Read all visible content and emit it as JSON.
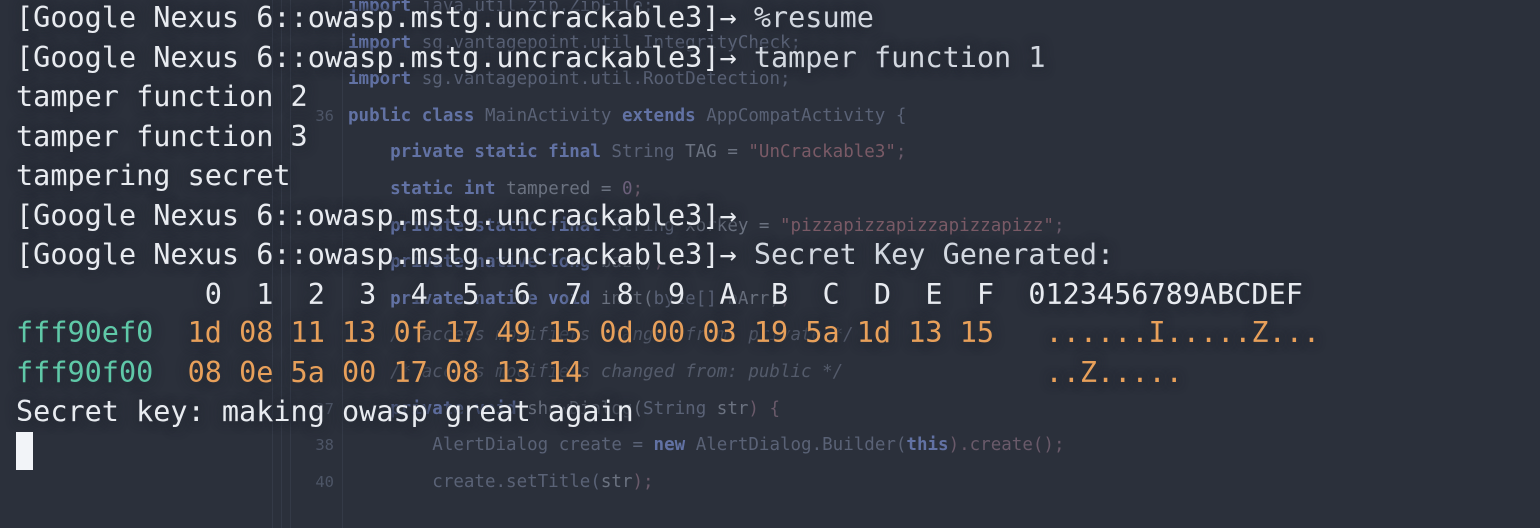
{
  "background_code": {
    "lines": [
      {
        "num": "",
        "tokens": [
          {
            "t": "import ",
            "c": "kw"
          },
          {
            "t": "java.util.zip.ZipFile;",
            "c": "typ"
          }
        ]
      },
      {
        "num": "",
        "tokens": [
          {
            "t": "import ",
            "c": "kw"
          },
          {
            "t": "sg.vantagepoint.util.IntegrityCheck;",
            "c": "typ"
          }
        ]
      },
      {
        "num": "",
        "tokens": [
          {
            "t": "import ",
            "c": "kw"
          },
          {
            "t": "sg.vantagepoint.util.RootDetection;",
            "c": "typ"
          }
        ]
      },
      {
        "num": "36",
        "tokens": [
          {
            "t": "public class ",
            "c": "kw"
          },
          {
            "t": "MainActivity ",
            "c": "typ"
          },
          {
            "t": "extends ",
            "c": "kw"
          },
          {
            "t": "AppCompatActivity {",
            "c": "typ"
          }
        ]
      },
      {
        "num": "",
        "tokens": [
          {
            "t": "    private static final ",
            "c": "kw"
          },
          {
            "t": "String ",
            "c": "typ"
          },
          {
            "t": "TAG = ",
            "c": "id"
          },
          {
            "t": "\"UnCrackable3\"",
            "c": "str"
          },
          {
            "t": ";",
            "c": "pun"
          }
        ]
      },
      {
        "num": "",
        "tokens": [
          {
            "t": "    static ",
            "c": "kw"
          },
          {
            "t": "int ",
            "c": "kw"
          },
          {
            "t": "tampered = ",
            "c": "id"
          },
          {
            "t": "0",
            "c": "num"
          },
          {
            "t": ";",
            "c": "pun"
          }
        ]
      },
      {
        "num": "",
        "tokens": [
          {
            "t": "    private static final ",
            "c": "kw"
          },
          {
            "t": "String ",
            "c": "typ"
          },
          {
            "t": "xorkey = ",
            "c": "id"
          },
          {
            "t": "\"pizzapizzapizzapizzapizz\"",
            "c": "str"
          },
          {
            "t": ";",
            "c": "pun"
          }
        ]
      },
      {
        "num": "",
        "tokens": [
          {
            "t": "    private native long ",
            "c": "kw"
          },
          {
            "t": "baz()",
            "c": "id"
          },
          {
            "t": ";",
            "c": "pun"
          }
        ]
      },
      {
        "num": "",
        "tokens": [
          {
            "t": "    private native void ",
            "c": "kw"
          },
          {
            "t": "init(",
            "c": "id"
          },
          {
            "t": "byte[] ",
            "c": "typ"
          },
          {
            "t": "bArr)",
            "c": "id"
          },
          {
            "t": ";",
            "c": "pun"
          }
        ]
      },
      {
        "num": "",
        "tokens": [
          {
            "t": "    /* access modifiers changed from: private */",
            "c": "cmt"
          }
        ]
      },
      {
        "num": "",
        "tokens": [
          {
            "t": "    /* access modifiers changed from: public */",
            "c": "cmt"
          }
        ]
      },
      {
        "num": "37",
        "tokens": [
          {
            "t": "    private void ",
            "c": "kw"
          },
          {
            "t": "showDialog(",
            "c": "id"
          },
          {
            "t": "String ",
            "c": "typ"
          },
          {
            "t": "str",
            "c": "id"
          },
          {
            "t": ") {",
            "c": "pun"
          }
        ]
      },
      {
        "num": "38",
        "tokens": [
          {
            "t": "        AlertDialog create = ",
            "c": "typ"
          },
          {
            "t": "new ",
            "c": "kw"
          },
          {
            "t": "AlertDialog.Builder(",
            "c": "typ"
          },
          {
            "t": "this",
            "c": "kw"
          },
          {
            "t": ").create()",
            "c": "pun"
          },
          {
            "t": ";",
            "c": "pun"
          }
        ]
      },
      {
        "num": "40",
        "tokens": [
          {
            "t": "        create.setTitle(",
            "c": "typ"
          },
          {
            "t": "str",
            "c": "id"
          },
          {
            "t": ");",
            "c": "pun"
          }
        ]
      }
    ]
  },
  "terminal": {
    "device_prompt": "[Google Nexus 6::owasp.mstg.uncrackable3]",
    "arrow": "→",
    "lines": [
      {
        "kind": "prompt",
        "prompt": "[Google Nexus 6::owasp.mstg.uncrackable3]",
        "arrow": "→",
        "command": " %resume"
      },
      {
        "kind": "prompt",
        "prompt": "[Google Nexus 6::owasp.mstg.uncrackable3]",
        "arrow": "→",
        "command": " tamper function 1"
      },
      {
        "kind": "output",
        "text": "tamper function 2"
      },
      {
        "kind": "output",
        "text": "tamper function 3"
      },
      {
        "kind": "output",
        "text": "tampering secret"
      },
      {
        "kind": "prompt",
        "prompt": "[Google Nexus 6::owasp.mstg.uncrackable3]",
        "arrow": "→",
        "command": ""
      },
      {
        "kind": "prompt",
        "prompt": "[Google Nexus 6::owasp.mstg.uncrackable3]",
        "arrow": "→",
        "command": " Secret Key Generated:"
      }
    ],
    "hexdump": {
      "header_cols": "           0  1  2  3  4  5  6  7  8  9  A  B  C  D  E  F  0123456789ABCDEF",
      "rows": [
        {
          "offset": "fff90ef0",
          "bytes": "1d 08 11 13 0f 17 49 15 0d 00 03 19 5a 1d 13 15",
          "ascii": "......I.....Z..."
        },
        {
          "offset": "fff90f00",
          "bytes": "08 0e 5a 00 17 08 13 14",
          "ascii": "..Z....."
        }
      ]
    },
    "result_line": "Secret key: making owasp great again",
    "cursor_visible": true
  },
  "colors": {
    "background": "#2b303b",
    "foreground": "#e8ebf0",
    "hex_offset": "#5fc9a8",
    "hex_bytes": "#e8a05a",
    "cursor": "#f2f4f8"
  }
}
